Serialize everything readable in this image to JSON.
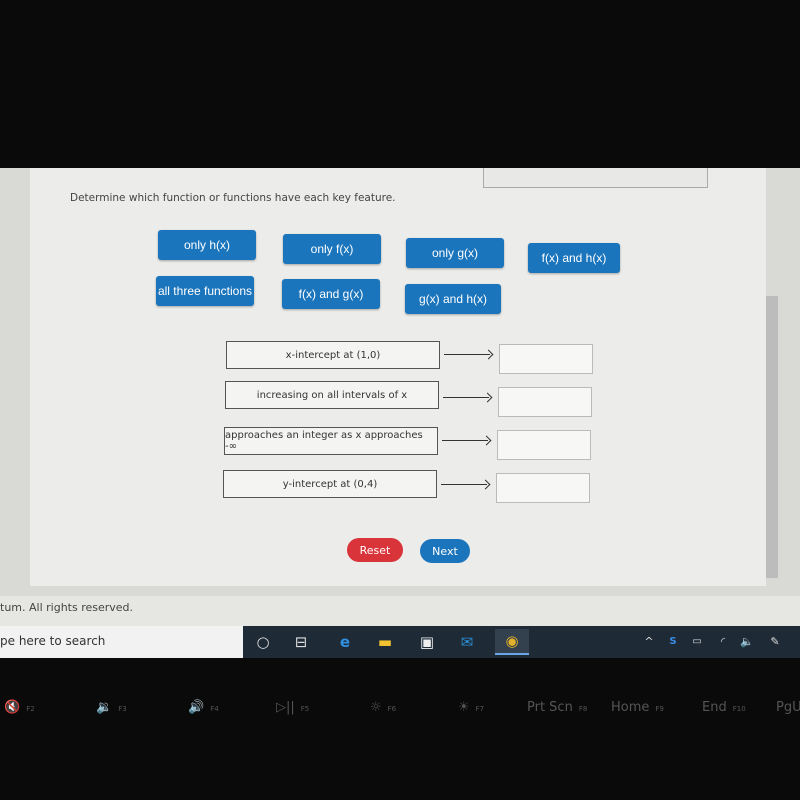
{
  "instruction": "Determine which function or functions have each key feature.",
  "choices": [
    {
      "label": "only h(x)"
    },
    {
      "label": "only f(x)"
    },
    {
      "label": "only g(x)"
    },
    {
      "label": "f(x) and h(x)"
    },
    {
      "label": "all three functions"
    },
    {
      "label": "f(x) and g(x)"
    },
    {
      "label": "g(x) and h(x)"
    }
  ],
  "features": [
    {
      "label": "x-intercept at (1,0)",
      "answer": ""
    },
    {
      "label": "increasing on all intervals of x",
      "answer": ""
    },
    {
      "label": "approaches an integer as x approaches -∞",
      "answer": ""
    },
    {
      "label": "y-intercept at (0,4)",
      "answer": ""
    }
  ],
  "buttons": {
    "reset": "Reset",
    "next": "Next"
  },
  "colors": {
    "chip": "#1b75bc",
    "reset": "#d9343a",
    "next": "#1b75bc"
  },
  "footer": "tum. All rights reserved.",
  "taskbar": {
    "search_placeholder": "pe here to search",
    "icons": [
      "cortana-icon",
      "task-view-icon",
      "edge-icon",
      "file-explorer-icon",
      "store-icon",
      "mail-icon",
      "chrome-icon"
    ],
    "tray": [
      "chevron-up-icon",
      "shield-icon",
      "battery-icon",
      "wifi-icon",
      "volume-icon",
      "pen-icon"
    ]
  },
  "keys": [
    {
      "label": "🔇",
      "fn": "F2"
    },
    {
      "label": "🔉",
      "fn": "F3"
    },
    {
      "label": "🔊",
      "fn": "F4"
    },
    {
      "label": "▷||",
      "fn": "F5"
    },
    {
      "label": "☼",
      "fn": "F6"
    },
    {
      "label": "☀",
      "fn": "F7"
    },
    {
      "label": "Prt Scn",
      "fn": "F8"
    },
    {
      "label": "Home",
      "fn": "F9"
    },
    {
      "label": "End",
      "fn": "F10"
    },
    {
      "label": "PgU",
      "fn": ""
    }
  ]
}
